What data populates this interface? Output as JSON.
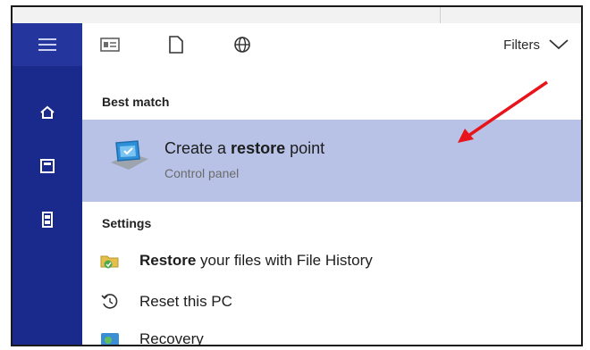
{
  "toolbar": {
    "filters_label": "Filters"
  },
  "best_match": {
    "heading": "Best match",
    "title_before": "Create a ",
    "title_bold": "restore",
    "title_after": " point",
    "subtitle": "Control panel"
  },
  "settings": {
    "heading": "Settings",
    "items": [
      {
        "bold": "Restore",
        "text": " your files with File History",
        "icon": "file-history-icon"
      },
      {
        "bold": "",
        "text": "Reset this PC",
        "icon": "reset-icon"
      },
      {
        "bold": "",
        "text": "Recovery",
        "icon": "recovery-icon"
      }
    ]
  },
  "sidebar": {
    "items": [
      "menu-icon",
      "home-icon",
      "documents-icon",
      "device-icon"
    ]
  },
  "colors": {
    "sidebar": "#1a2a8c",
    "highlight": "#b7c2e6",
    "annotation_arrow": "#e8141b"
  }
}
